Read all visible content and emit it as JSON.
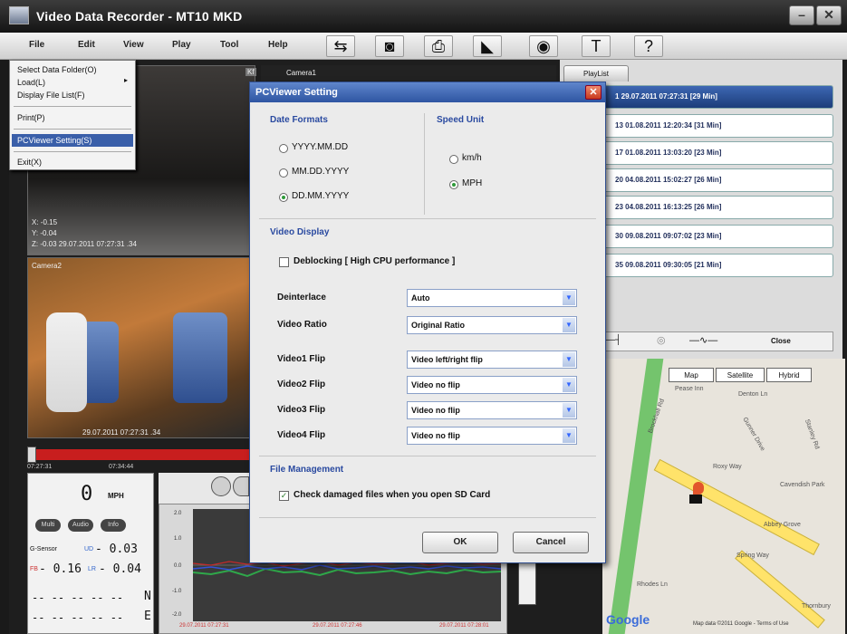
{
  "app": {
    "title": "Video Data Recorder - MT10 MKD"
  },
  "menu": [
    "File",
    "Edit",
    "View",
    "Play",
    "Tool",
    "Help"
  ],
  "toolbar_icons": [
    "folder-icon",
    "camera-icon",
    "print-icon",
    "clapper-icon",
    "disc-icon",
    "hammer-icon",
    "help-icon"
  ],
  "toolbar_glyphs": [
    "⇆",
    "◙",
    "⎙",
    "◣",
    "◉",
    "T",
    "?"
  ],
  "file_menu": {
    "items": [
      "Select Data Folder(O)",
      "Load(L)",
      "Display File List(F)",
      "Print(P)",
      "PCViewer Setting(S)",
      "Exit(X)"
    ],
    "highlighted": "PCViewer Setting(S)"
  },
  "video": {
    "cam1_label": "Camera1",
    "cam1_info": [
      "X: -0.15",
      "Y: -0.04",
      "Z: -0.03  29.07.2011 07:27:31 .34"
    ],
    "cam2_label": "Camera2",
    "cam2_info": "29.07.2011 07:27:31 .34",
    "time_start": "07:27:31",
    "time_mid": "07:34:44"
  },
  "speed": {
    "value": "0",
    "unit": "MPH",
    "gsensor_label": "G-Sensor",
    "ud": "UD",
    "ud_val": "- 0.03",
    "fb": "FB",
    "fb_val": "- 0.16",
    "lr": "LR",
    "lr_val": "- 0.04",
    "dir_n": "N",
    "dir_e": "E",
    "btn_a": "Multi",
    "btn_b": "Audio",
    "btn_c": "Info"
  },
  "graph": {
    "timestamps": [
      "29.07.2011 07:27:31",
      "29.07.2011 07:27:46",
      "29.07.2011 07:28:01"
    ],
    "yticks": [
      "2.0",
      "1.0",
      "0.0",
      "-1.0",
      "-2.0"
    ]
  },
  "playlist": {
    "tab": "PlayList",
    "items": [
      "1  29.07.2011 07:27:31 [29 Min]",
      "13  01.08.2011 12:20:34 [31 Min]",
      "17  01.08.2011 13:03:20 [23 Min]",
      "20  04.08.2011 15:02:27 [26 Min]",
      "23  04.08.2011 16:13:25 [26 Min]",
      "30  09.08.2011 09:07:02 [23 Min]",
      "35  09.08.2011 09:30:05 [21 Min]"
    ],
    "selected_index": 0,
    "close": "Close"
  },
  "map": {
    "tabs": [
      "Map",
      "Satellite",
      "Hybrid"
    ],
    "labels": [
      "Pease Inn",
      "Denton Ln",
      "Brockhall Rd",
      "Roxy Way",
      "Gunner Drive",
      "Stanley Rd",
      "Cavendish Park",
      "Abbey Grove",
      "Spring Way",
      "Rhodes Ln",
      "Thornbury"
    ],
    "attribution": "Map data ©2011 Google - Terms of Use",
    "logo": "Google"
  },
  "dialog": {
    "title": "PCViewer Setting",
    "date_section": "Date Formats",
    "date_options": [
      "YYYY.MM.DD",
      "MM.DD.YYYY",
      "DD.MM.YYYY"
    ],
    "date_selected": 2,
    "speed_section": "Speed Unit",
    "speed_options": [
      "km/h",
      "MPH"
    ],
    "speed_selected": 1,
    "video_section": "Video Display",
    "deblocking": "Deblocking [ High CPU performance ]",
    "rows": [
      {
        "label": "Deinterlace",
        "value": "Auto"
      },
      {
        "label": "Video Ratio",
        "value": "Original Ratio"
      },
      {
        "label": "Video1 Flip",
        "value": "Video left/right flip"
      },
      {
        "label": "Video2 Flip",
        "value": "Video no flip"
      },
      {
        "label": "Video3 Flip",
        "value": "Video no flip"
      },
      {
        "label": "Video4 Flip",
        "value": "Video no flip"
      }
    ],
    "file_section": "File Management",
    "check_damaged": "Check damaged files when you open SD Card",
    "check_damaged_on": true,
    "ok": "OK",
    "cancel": "Cancel"
  }
}
